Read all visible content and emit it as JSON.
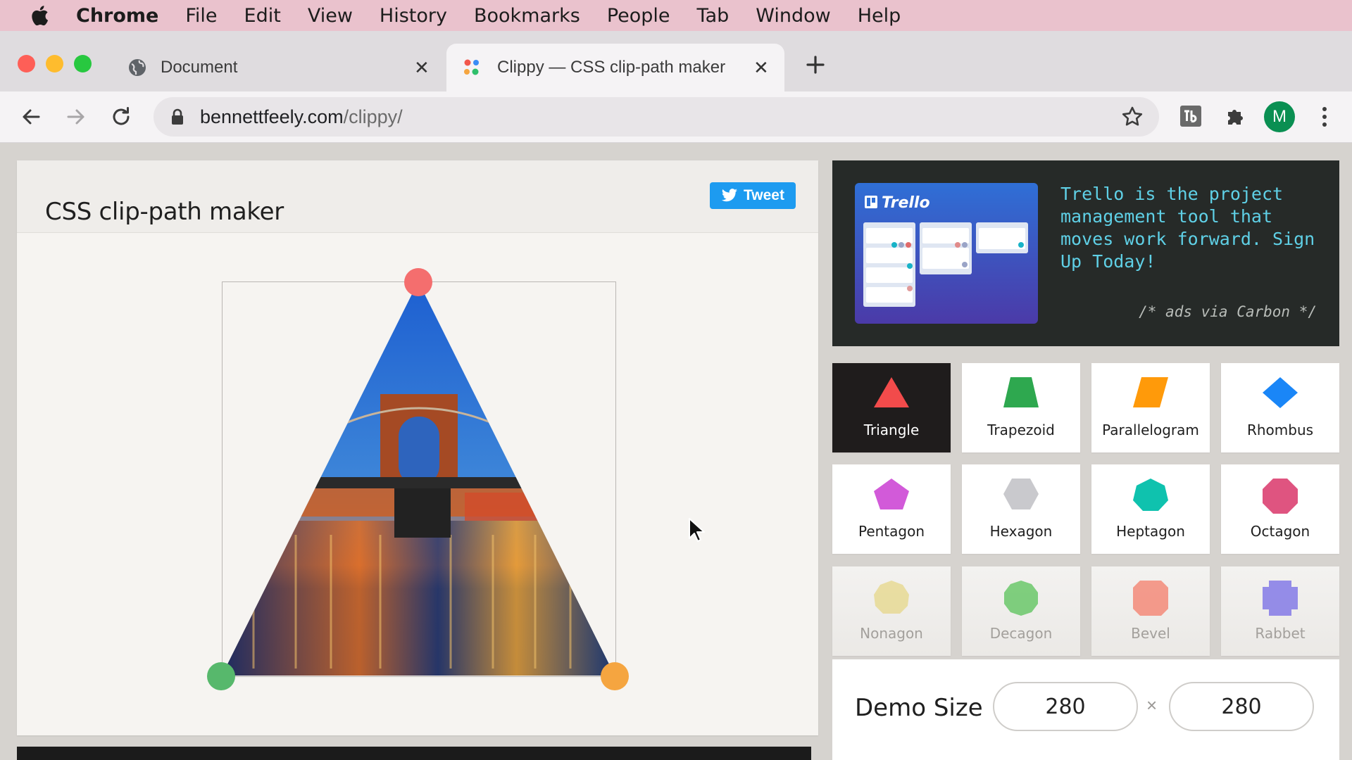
{
  "menubar": {
    "app": "Chrome",
    "items": [
      "File",
      "Edit",
      "View",
      "History",
      "Bookmarks",
      "People",
      "Tab",
      "Window",
      "Help"
    ]
  },
  "tabs": [
    {
      "title": "Document",
      "icon": "globe-icon",
      "active": false
    },
    {
      "title": "Clippy — CSS clip-path maker",
      "icon": "clippy-favicon-icon",
      "active": true
    }
  ],
  "address_bar": {
    "domain": "bennettfeely.com",
    "path": "/clippy/"
  },
  "profile_initial": "M",
  "page": {
    "title": "CSS clip-path maker",
    "tweet_label": "Tweet"
  },
  "ad": {
    "brand": "Trello",
    "text": "Trello is the project management tool that moves work forward. Sign Up Today!",
    "credit": "/* ads via Carbon */"
  },
  "shapes": [
    {
      "label": "Triangle",
      "color": "#f24b4b",
      "selected": true
    },
    {
      "label": "Trapezoid",
      "color": "#2ea84f"
    },
    {
      "label": "Parallelogram",
      "color": "#ff9a0a"
    },
    {
      "label": "Rhombus",
      "color": "#1a86f7"
    },
    {
      "label": "Pentagon",
      "color": "#d25ad9"
    },
    {
      "label": "Hexagon",
      "color": "#c9c9cd"
    },
    {
      "label": "Heptagon",
      "color": "#0fc2ae"
    },
    {
      "label": "Octagon",
      "color": "#df5480"
    },
    {
      "label": "Nonagon",
      "color": "#e6d682"
    },
    {
      "label": "Decagon",
      "color": "#4fc04f"
    },
    {
      "label": "Bevel",
      "color": "#f57662"
    },
    {
      "label": "Rabbet",
      "color": "#6e63e6"
    }
  ],
  "demo_size": {
    "label": "Demo Size",
    "width": "280",
    "height": "280",
    "separator": "×"
  },
  "colors": {
    "menubar": "#eac2cd",
    "handle_top": "#f46e6e",
    "handle_left": "#57b86c",
    "handle_right": "#f5a540",
    "tweet": "#1d9bf0"
  }
}
